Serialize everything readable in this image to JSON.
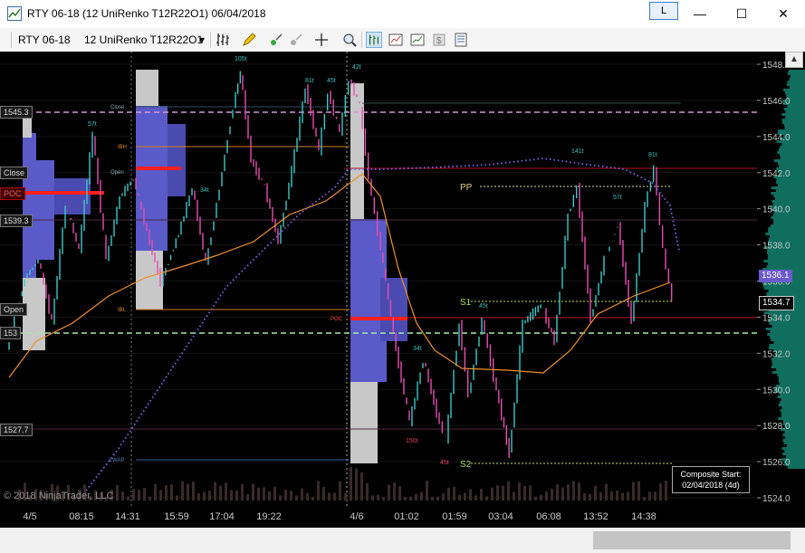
{
  "window": {
    "title": "RTY 06-18 (12 UniRenko T12R22O1)  06/04/2018",
    "link_button": "L",
    "minimize": "—",
    "maximize": "☐",
    "close": "✕"
  },
  "toolbar": {
    "instrument": "RTY 06-18",
    "bar_type": "12 UniRenko T12R22O1",
    "dropdown_icon": "▾"
  },
  "price_axis": {
    "ticks": [
      "1548.0",
      "1546.0",
      "1544.0",
      "1542.0",
      "1540.0",
      "1538.0",
      "1536.0",
      "1534.0",
      "1532.0",
      "1530.0",
      "1528.0",
      "1526.0",
      "1524.0"
    ],
    "last_price": "1536.1",
    "marker_price": "1534.7",
    "last_price_color": "#6a5acd"
  },
  "time_axis": {
    "labels": [
      "4/5",
      "08:15",
      "14:31",
      "15:59",
      "17:04",
      "19:22",
      "4/6",
      "01:02",
      "01:59",
      "03:04",
      "06:08",
      "13:52",
      "14:38"
    ]
  },
  "left_tags": {
    "t1": "1545.3",
    "t2": "1539.3",
    "t3": "1527.7",
    "t4": "POC",
    "t5": "Close",
    "t6": "Open",
    "t7": "153"
  },
  "chart_labels": {
    "pp": "PP",
    "s1": "S1",
    "s2": "S2",
    "poc": "POC",
    "close": "Close",
    "ibh": "IBH",
    "ibl": "IBL",
    "vwap": "VWAP",
    "open": "Open",
    "ticks_105": "105t",
    "ticks_81a": "81t",
    "ticks_45a": "45t",
    "ticks_42": "42t",
    "ticks_57a": "57t",
    "ticks_34": "34t",
    "ticks_81b": "81t",
    "ticks_141": "141t",
    "ticks_57b": "57t",
    "ticks_34b": "34t",
    "ticks_45b": "45t",
    "ticks_150": "150t",
    "ticks_45c": "45t"
  },
  "copyright": "© 2018 NinjaTrader, LLC",
  "composite": {
    "line1": "Composite Start:",
    "line2": "02/04/2018 (4d)"
  },
  "colors": {
    "background": "#000000",
    "profile": "#6b6bd6",
    "candle_up": "#3cc9c9",
    "candle_down": "#e64fb0",
    "poc": "#ff1a1a",
    "vwap": "#7b68ee",
    "ema": "#f0902a",
    "grid": "#1e1e1e"
  }
}
